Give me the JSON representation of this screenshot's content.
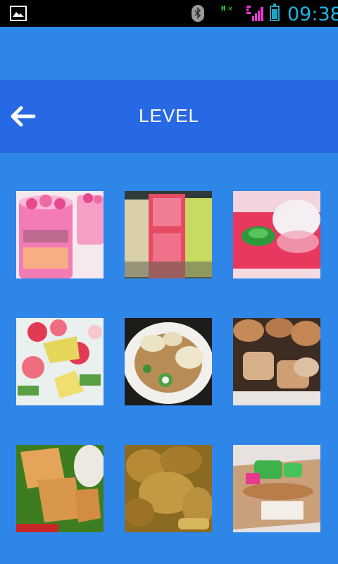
{
  "status_bar": {
    "time": "09:38",
    "data_indicator": "H ✕",
    "icons": [
      "gallery-icon",
      "bluetooth-icon",
      "data-activity-icon",
      "signal-icon",
      "battery-icon"
    ]
  },
  "header": {
    "title": "LEVEL",
    "back_icon": "arrow-left-icon"
  },
  "levels": [
    {
      "name": "pink-drink-dessert"
    },
    {
      "name": "colorful-drinks"
    },
    {
      "name": "green-dessert-pink-sauce"
    },
    {
      "name": "fruit-ice-salad"
    },
    {
      "name": "plate-with-crackers"
    },
    {
      "name": "fried-snacks"
    },
    {
      "name": "wrapped-food-banana-leaf"
    },
    {
      "name": "curry-dish"
    },
    {
      "name": "colorful-sweet-snack"
    }
  ]
}
